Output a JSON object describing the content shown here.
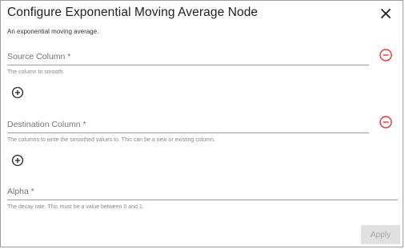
{
  "dialog": {
    "title": "Configure Exponential Moving Average Node",
    "description": "An exponential moving average.",
    "close_icon": "close-icon"
  },
  "fields": {
    "source_column": {
      "label": "Source Column *",
      "value": "",
      "hint": "The column to smooth.",
      "remove_icon": "remove-circle-icon",
      "add_icon": "add-circle-icon"
    },
    "destination_column": {
      "label": "Destination Column *",
      "value": "",
      "hint": "The columns to write the smoothed values to. This can be a new or existing column.",
      "remove_icon": "remove-circle-icon",
      "add_icon": "add-circle-icon"
    },
    "alpha": {
      "label": "Alpha *",
      "value": "",
      "hint": "The decay rate. This must be a value between 0 and 1."
    }
  },
  "footer": {
    "apply_label": "Apply",
    "apply_disabled": true
  },
  "colors": {
    "remove_icon": "#e53935",
    "apply_bg": "#e0e0e0",
    "apply_text": "#a6a6a6"
  }
}
